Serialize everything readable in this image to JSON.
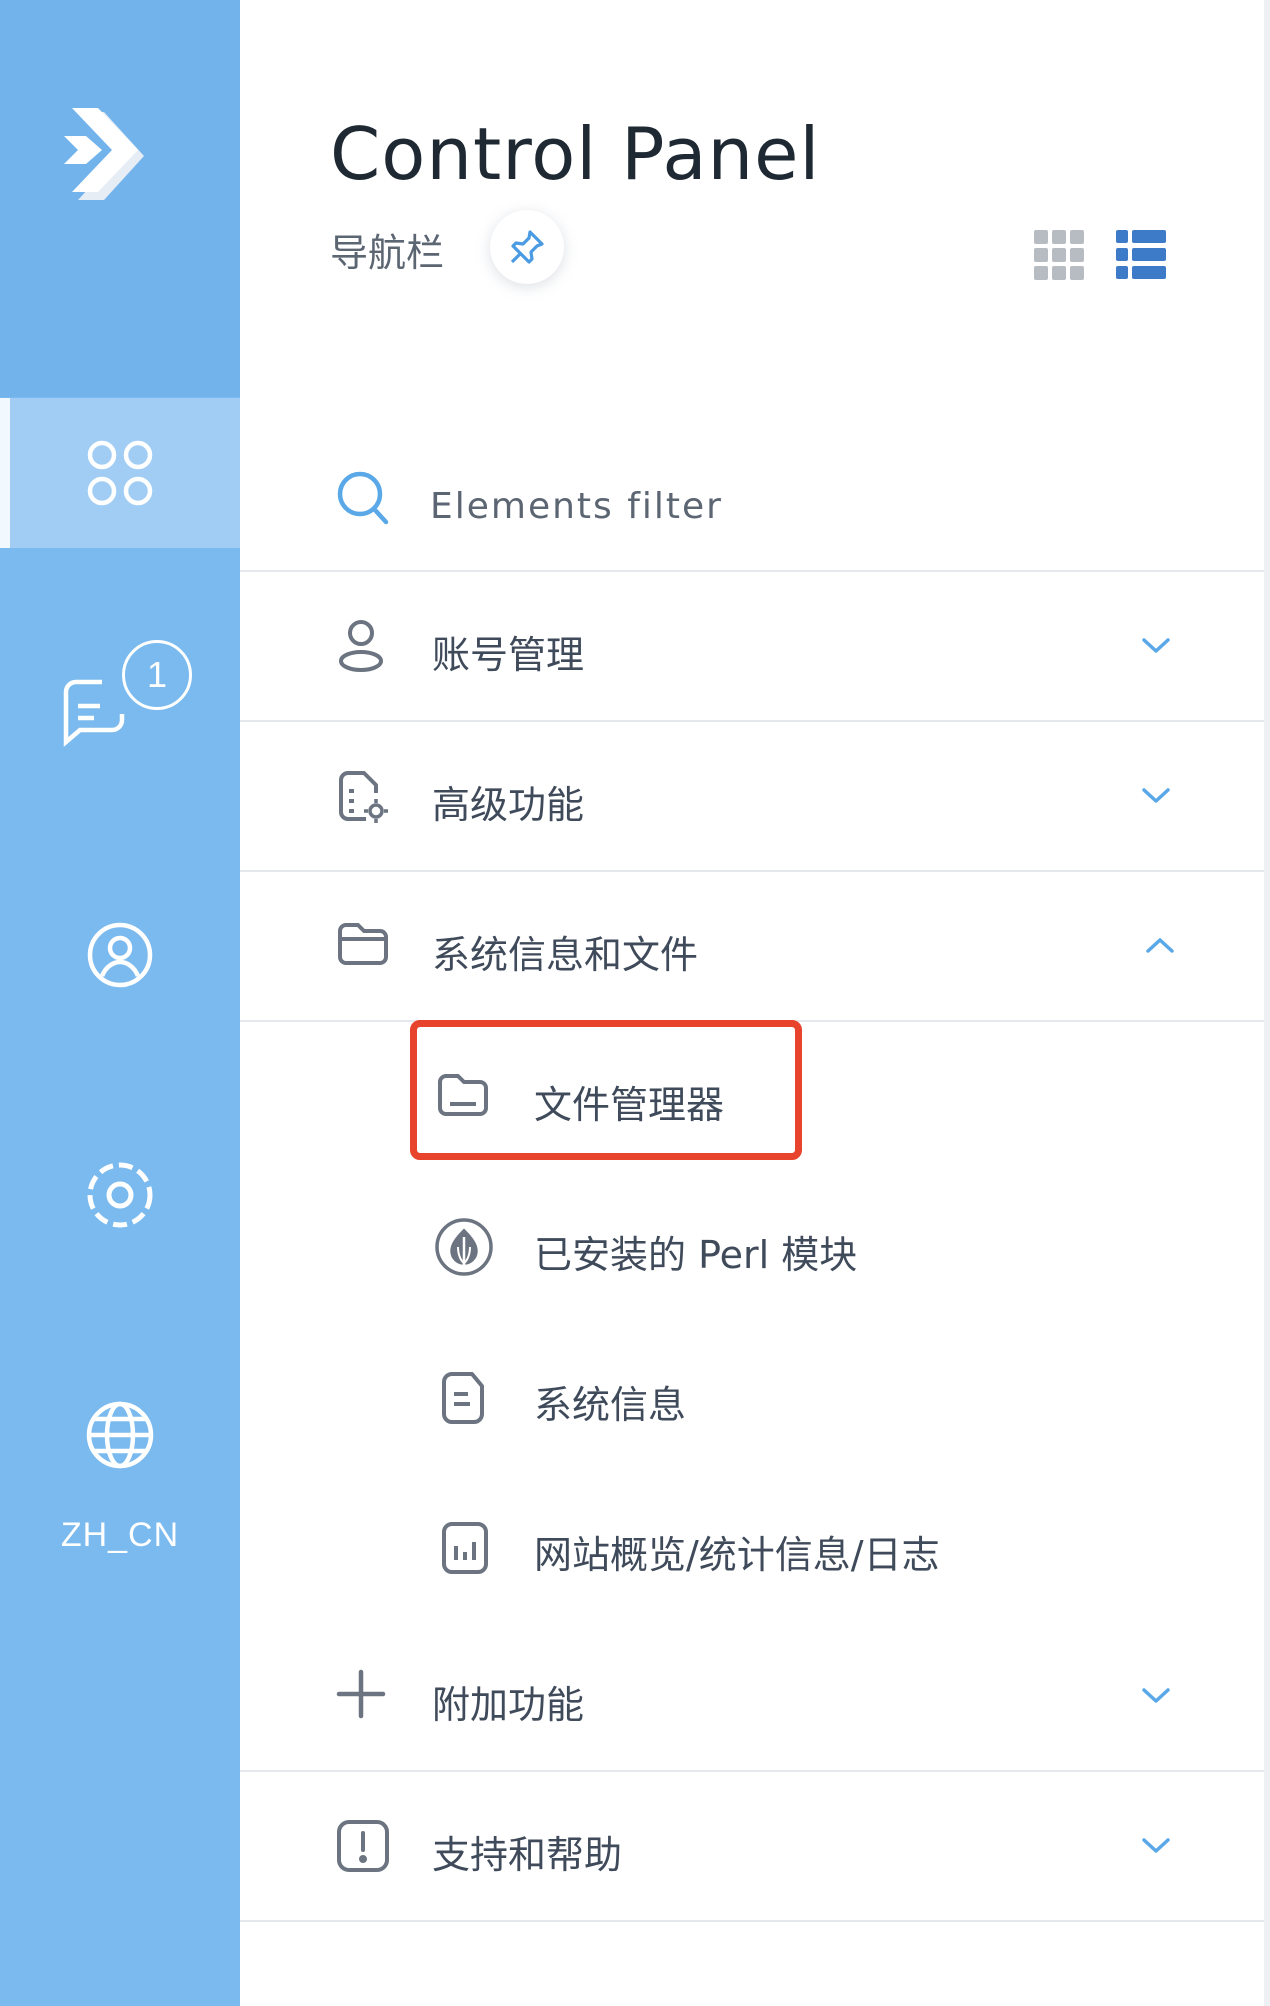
{
  "app": {
    "title": "Control Panel",
    "subtitle": "导航栏"
  },
  "rail": {
    "notification_count": "1",
    "language": "ZH_CN"
  },
  "filter": {
    "placeholder": "Elements filter"
  },
  "sections": {
    "account": "账号管理",
    "advanced": "高级功能",
    "sysinfo": "系统信息和文件",
    "addons": "附加功能",
    "support": "支持和帮助"
  },
  "sysinfo_items": {
    "file_manager": "文件管理器",
    "perl_modules": "已安装的 Perl 模块",
    "system_info": "系统信息",
    "site_stats": "网站概览/统计信息/日志"
  },
  "colors": {
    "rail": "#7bbaee",
    "rail_active": "#a1cdf4",
    "accent": "#3d7bc8",
    "highlight": "#e8432d"
  }
}
